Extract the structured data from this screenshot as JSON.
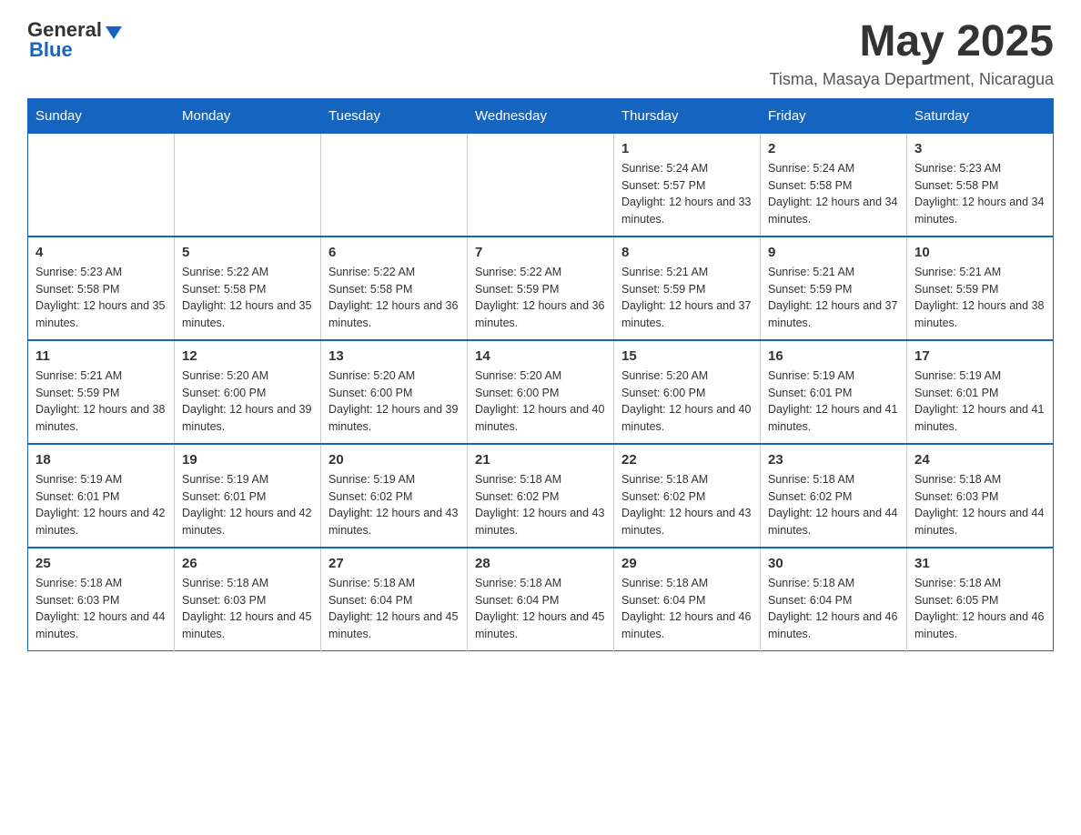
{
  "header": {
    "logo_general": "General",
    "logo_blue": "Blue",
    "month_year": "May 2025",
    "location": "Tisma, Masaya Department, Nicaragua"
  },
  "days_of_week": [
    "Sunday",
    "Monday",
    "Tuesday",
    "Wednesday",
    "Thursday",
    "Friday",
    "Saturday"
  ],
  "weeks": [
    [
      {
        "day": "",
        "info": ""
      },
      {
        "day": "",
        "info": ""
      },
      {
        "day": "",
        "info": ""
      },
      {
        "day": "",
        "info": ""
      },
      {
        "day": "1",
        "info": "Sunrise: 5:24 AM\nSunset: 5:57 PM\nDaylight: 12 hours and 33 minutes."
      },
      {
        "day": "2",
        "info": "Sunrise: 5:24 AM\nSunset: 5:58 PM\nDaylight: 12 hours and 34 minutes."
      },
      {
        "day": "3",
        "info": "Sunrise: 5:23 AM\nSunset: 5:58 PM\nDaylight: 12 hours and 34 minutes."
      }
    ],
    [
      {
        "day": "4",
        "info": "Sunrise: 5:23 AM\nSunset: 5:58 PM\nDaylight: 12 hours and 35 minutes."
      },
      {
        "day": "5",
        "info": "Sunrise: 5:22 AM\nSunset: 5:58 PM\nDaylight: 12 hours and 35 minutes."
      },
      {
        "day": "6",
        "info": "Sunrise: 5:22 AM\nSunset: 5:58 PM\nDaylight: 12 hours and 36 minutes."
      },
      {
        "day": "7",
        "info": "Sunrise: 5:22 AM\nSunset: 5:59 PM\nDaylight: 12 hours and 36 minutes."
      },
      {
        "day": "8",
        "info": "Sunrise: 5:21 AM\nSunset: 5:59 PM\nDaylight: 12 hours and 37 minutes."
      },
      {
        "day": "9",
        "info": "Sunrise: 5:21 AM\nSunset: 5:59 PM\nDaylight: 12 hours and 37 minutes."
      },
      {
        "day": "10",
        "info": "Sunrise: 5:21 AM\nSunset: 5:59 PM\nDaylight: 12 hours and 38 minutes."
      }
    ],
    [
      {
        "day": "11",
        "info": "Sunrise: 5:21 AM\nSunset: 5:59 PM\nDaylight: 12 hours and 38 minutes."
      },
      {
        "day": "12",
        "info": "Sunrise: 5:20 AM\nSunset: 6:00 PM\nDaylight: 12 hours and 39 minutes."
      },
      {
        "day": "13",
        "info": "Sunrise: 5:20 AM\nSunset: 6:00 PM\nDaylight: 12 hours and 39 minutes."
      },
      {
        "day": "14",
        "info": "Sunrise: 5:20 AM\nSunset: 6:00 PM\nDaylight: 12 hours and 40 minutes."
      },
      {
        "day": "15",
        "info": "Sunrise: 5:20 AM\nSunset: 6:00 PM\nDaylight: 12 hours and 40 minutes."
      },
      {
        "day": "16",
        "info": "Sunrise: 5:19 AM\nSunset: 6:01 PM\nDaylight: 12 hours and 41 minutes."
      },
      {
        "day": "17",
        "info": "Sunrise: 5:19 AM\nSunset: 6:01 PM\nDaylight: 12 hours and 41 minutes."
      }
    ],
    [
      {
        "day": "18",
        "info": "Sunrise: 5:19 AM\nSunset: 6:01 PM\nDaylight: 12 hours and 42 minutes."
      },
      {
        "day": "19",
        "info": "Sunrise: 5:19 AM\nSunset: 6:01 PM\nDaylight: 12 hours and 42 minutes."
      },
      {
        "day": "20",
        "info": "Sunrise: 5:19 AM\nSunset: 6:02 PM\nDaylight: 12 hours and 43 minutes."
      },
      {
        "day": "21",
        "info": "Sunrise: 5:18 AM\nSunset: 6:02 PM\nDaylight: 12 hours and 43 minutes."
      },
      {
        "day": "22",
        "info": "Sunrise: 5:18 AM\nSunset: 6:02 PM\nDaylight: 12 hours and 43 minutes."
      },
      {
        "day": "23",
        "info": "Sunrise: 5:18 AM\nSunset: 6:02 PM\nDaylight: 12 hours and 44 minutes."
      },
      {
        "day": "24",
        "info": "Sunrise: 5:18 AM\nSunset: 6:03 PM\nDaylight: 12 hours and 44 minutes."
      }
    ],
    [
      {
        "day": "25",
        "info": "Sunrise: 5:18 AM\nSunset: 6:03 PM\nDaylight: 12 hours and 44 minutes."
      },
      {
        "day": "26",
        "info": "Sunrise: 5:18 AM\nSunset: 6:03 PM\nDaylight: 12 hours and 45 minutes."
      },
      {
        "day": "27",
        "info": "Sunrise: 5:18 AM\nSunset: 6:04 PM\nDaylight: 12 hours and 45 minutes."
      },
      {
        "day": "28",
        "info": "Sunrise: 5:18 AM\nSunset: 6:04 PM\nDaylight: 12 hours and 45 minutes."
      },
      {
        "day": "29",
        "info": "Sunrise: 5:18 AM\nSunset: 6:04 PM\nDaylight: 12 hours and 46 minutes."
      },
      {
        "day": "30",
        "info": "Sunrise: 5:18 AM\nSunset: 6:04 PM\nDaylight: 12 hours and 46 minutes."
      },
      {
        "day": "31",
        "info": "Sunrise: 5:18 AM\nSunset: 6:05 PM\nDaylight: 12 hours and 46 minutes."
      }
    ]
  ]
}
